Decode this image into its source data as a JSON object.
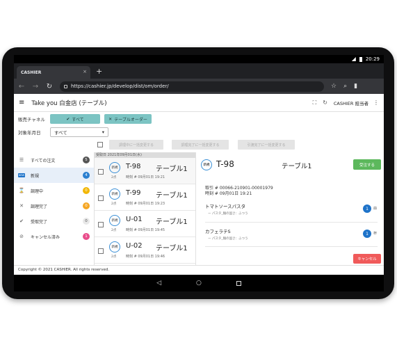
{
  "statusbar": {
    "time": "20:29"
  },
  "browser": {
    "tab_title": "CASHIER",
    "tab_close": "×",
    "new_tab": "+",
    "url": "https://cashier.jp/develop/dist/om/order/"
  },
  "header": {
    "title": "Take you 白金店 (テーブル)",
    "staff": "CASHIER 担当者"
  },
  "filters": {
    "channel_label": "販売チャネル",
    "channel_all": "すべて",
    "channel_table": "テーブルオーダー",
    "date_label": "対象年月日",
    "date_value": "すべて"
  },
  "bulk_actions": {
    "b1": "調理中に一括変更する",
    "b2": "調理完了に一括変更する",
    "b3": "引渡完了に一括変更する"
  },
  "sidebar": {
    "items": [
      {
        "label": "すべての注文",
        "count": "5",
        "color": "#555555",
        "icon": "list-icon"
      },
      {
        "label": "新規",
        "count": "4",
        "color": "#2a7fd0",
        "icon": "new-badge-icon"
      },
      {
        "label": "調理中",
        "count": "0",
        "color": "#f2b705",
        "icon": "hourglass-icon"
      },
      {
        "label": "調理完了",
        "count": "0",
        "color": "#f5a623",
        "icon": "cutlery-icon"
      },
      {
        "label": "受取完了",
        "count": "0",
        "color": "#e8e8e8",
        "icon": "check-circle-icon"
      },
      {
        "label": "キャンセル済み",
        "count": "1",
        "color": "#e94d8b",
        "icon": "ban-icon"
      }
    ]
  },
  "orders": {
    "date_header": "受取日 2021年09月01日(水)",
    "items": [
      {
        "status": "新規",
        "pieces": "2点",
        "number": "T-98",
        "table": "テーブル1",
        "time": "時刻 # 09月01日 19:21"
      },
      {
        "status": "新規",
        "pieces": "2点",
        "number": "T-99",
        "table": "テーブル1",
        "time": "時刻 # 09月01日 19:23"
      },
      {
        "status": "新規",
        "pieces": "2点",
        "number": "U-01",
        "table": "テーブル1",
        "time": "時刻 # 09月01日 19:45"
      },
      {
        "status": "新規",
        "pieces": "2点",
        "number": "U-02",
        "table": "テーブル1",
        "time": "時刻 # 09月01日 19:46"
      }
    ]
  },
  "detail": {
    "status": "新規",
    "number": "T-98",
    "table": "テーブル1",
    "accept_label": "受注する",
    "txn": "取引 # 00066-210901-00001979",
    "time": "時刻 # 09月01日 19:21",
    "items": [
      {
        "name": "トマトソースパスタ",
        "option": "ー パスタ_麺の固さ：ふつう",
        "qty": "1",
        "unit": "皿"
      },
      {
        "name": "カフェラテS",
        "option": "ー パスタ_麺の固さ：ふつう",
        "qty": "1",
        "unit": "杯"
      }
    ],
    "cancel_label": "キャンセル"
  },
  "footer": {
    "copyright": "Copyright © 2021 CASHIER. All rights reserved."
  }
}
